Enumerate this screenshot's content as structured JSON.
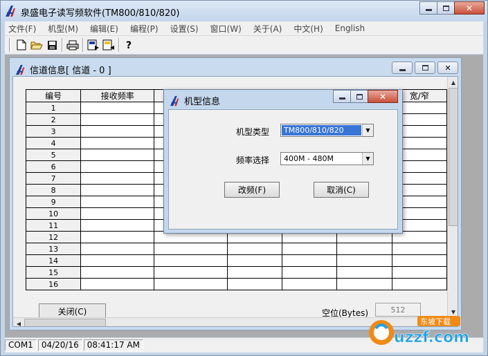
{
  "app": {
    "title": "泉盛电子读写频软件(TM800/810/820)"
  },
  "menu": [
    "文件(F)",
    "机型(M)",
    "编辑(E)",
    "编程(P)",
    "设置(S)",
    "窗口(W)",
    "关于(A)",
    "中文(H)",
    "English"
  ],
  "toolbar": {
    "icons": [
      "new-file-icon",
      "open-folder-icon",
      "save-icon",
      "print-icon",
      "read-radio-icon",
      "write-radio-icon",
      "help-icon"
    ]
  },
  "channel_window": {
    "title": "信道信息[ 信道 - 0 ]",
    "columns": [
      "编号",
      "接收频率",
      "",
      "",
      "",
      "",
      "宽/窄"
    ],
    "rows": [
      "1",
      "2",
      "3",
      "4",
      "5",
      "6",
      "7",
      "8",
      "9",
      "10",
      "11",
      "12",
      "13",
      "14",
      "15",
      "16"
    ],
    "close_label": "关闭(C)",
    "space_label": "空位(Bytes)",
    "space_value": "512"
  },
  "dialog": {
    "title": "机型信息",
    "model_label": "机型类型",
    "model_value": "TM800/810/820",
    "freq_label": "频率选择",
    "freq_value": "400M - 480M",
    "change_label": "改频(F)",
    "cancel_label": "取消(C)"
  },
  "status": {
    "port": "COM1",
    "date": "04/20/16",
    "time": "08:41:17 AM"
  },
  "watermark": {
    "site": "uzzf.com",
    "tag": "东坡下载"
  },
  "colors": {
    "accent_blue": "#1d3f9e",
    "logo_red": "#d0201c",
    "selection": "#3875d7",
    "watermark_orange": "#f08a16"
  }
}
